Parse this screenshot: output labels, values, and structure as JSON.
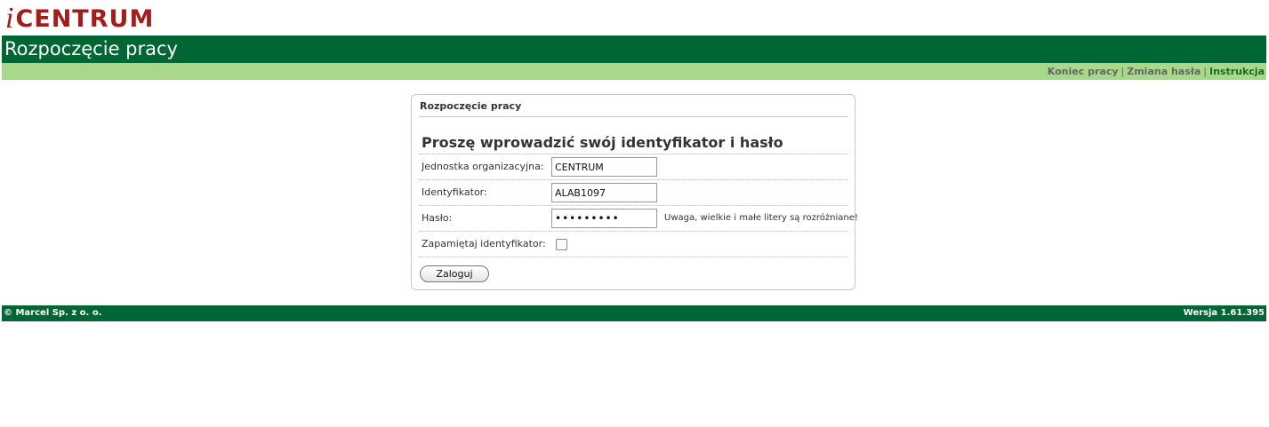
{
  "logo": {
    "prefix": "i",
    "text": "CENTRUM"
  },
  "header": {
    "title": "Rozpoczęcie pracy"
  },
  "nav": {
    "logout": "Koniec pracy",
    "change_password": "Zmiana hasła",
    "instructions": "Instrukcja",
    "separator": "|"
  },
  "panel": {
    "title": "Rozpoczęcie pracy",
    "heading": "Proszę wprowadzić swój identyfikator i hasło",
    "fields": {
      "unit_label": "Jednostka organizacyjna:",
      "unit_value": "CENTRUM",
      "id_label": "Identyfikator:",
      "id_value": "ALAB1097",
      "password_label": "Hasło:",
      "password_value": "•••••••••",
      "password_hint": "Uwaga, wielkie i małe litery są rozróżniane!",
      "remember_label": "Zapamiętaj identyfikator:"
    },
    "login_button": "Zaloguj"
  },
  "footer": {
    "copyright": "© Marcel Sp. z o. o.",
    "version": "Wersja 1.61.395"
  },
  "colors": {
    "brand_green": "#006633",
    "nav_green": "#a8d88a",
    "logo_red": "#a51c1c"
  }
}
